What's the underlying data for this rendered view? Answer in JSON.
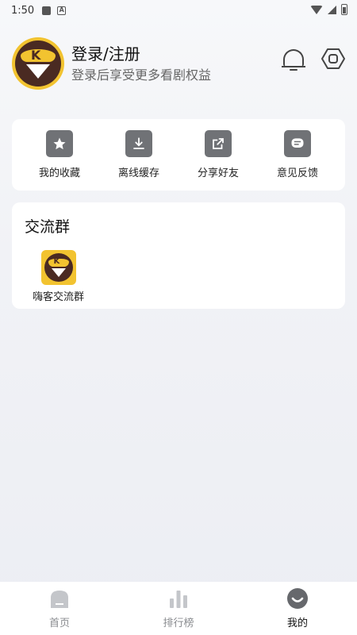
{
  "status_bar": {
    "time": "1:50",
    "icons": [
      "image-icon",
      "a-icon",
      "wifi-icon",
      "signal-icon",
      "battery-icon"
    ]
  },
  "profile": {
    "title": "登录/注册",
    "subtitle": "登录后享受更多看剧权益",
    "icons": [
      "bell-icon",
      "settings-icon"
    ]
  },
  "tools": [
    {
      "label": "我的收藏",
      "icon": "star-icon"
    },
    {
      "label": "离线缓存",
      "icon": "download-icon"
    },
    {
      "label": "分享好友",
      "icon": "share-icon"
    },
    {
      "label": "意见反馈",
      "icon": "feedback-icon"
    }
  ],
  "group": {
    "title": "交流群",
    "items": [
      {
        "label": "嗨客交流群",
        "icon": "app-logo-icon"
      }
    ]
  },
  "bottom_nav": [
    {
      "label": "首页",
      "icon": "home-icon",
      "active": false
    },
    {
      "label": "排行榜",
      "icon": "ranking-icon",
      "active": false
    },
    {
      "label": "我的",
      "icon": "profile-icon",
      "active": true
    }
  ],
  "colors": {
    "accent_yellow": "#f2c330",
    "brand_brown": "#4a2a22",
    "tool_icon_bg": "#707276",
    "card_bg": "#ffffff"
  }
}
